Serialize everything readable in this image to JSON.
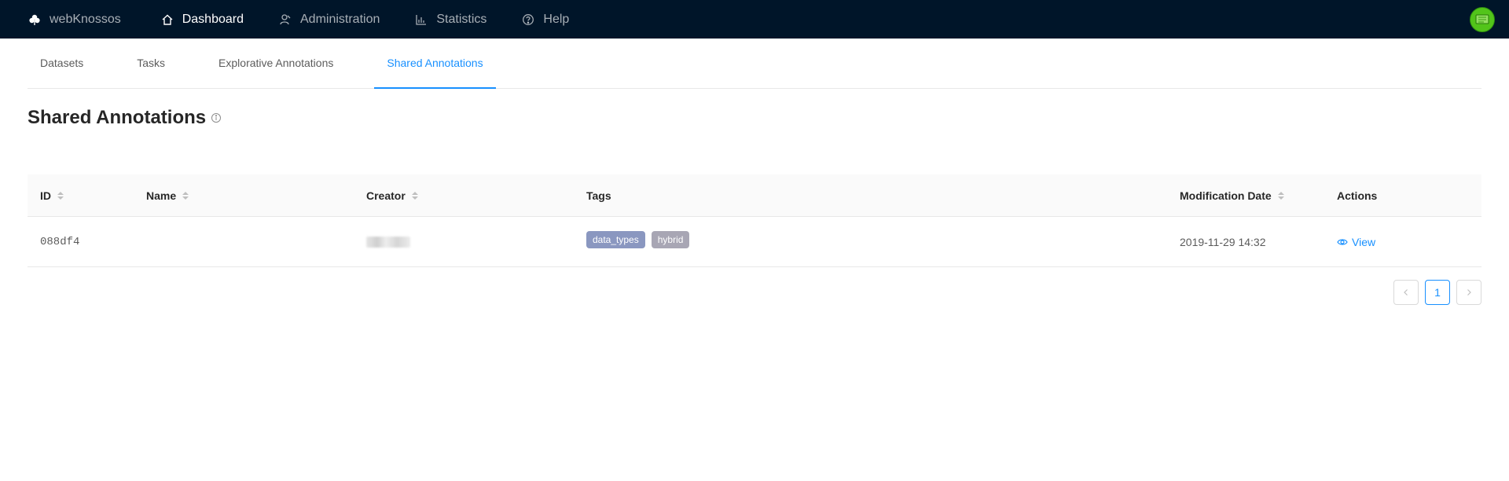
{
  "nav": {
    "brand": "webKnossos",
    "items": [
      {
        "label": "Dashboard",
        "icon": "home-icon",
        "active": true
      },
      {
        "label": "Administration",
        "icon": "user-icon",
        "active": false
      },
      {
        "label": "Statistics",
        "icon": "bar-chart-icon",
        "active": false
      },
      {
        "label": "Help",
        "icon": "question-circle-icon",
        "active": false
      }
    ]
  },
  "tabs": [
    {
      "label": "Datasets",
      "active": false
    },
    {
      "label": "Tasks",
      "active": false
    },
    {
      "label": "Explorative Annotations",
      "active": false
    },
    {
      "label": "Shared Annotations",
      "active": true
    }
  ],
  "page": {
    "title": "Shared Annotations"
  },
  "table": {
    "columns": [
      "ID",
      "Name",
      "Creator",
      "Tags",
      "Modification Date",
      "Actions"
    ],
    "rows": [
      {
        "id": "088df4",
        "name": "",
        "creator": "",
        "tags": [
          {
            "label": "data_types",
            "color": "#8a97c0"
          },
          {
            "label": "hybrid",
            "color": "#a8a6b4"
          }
        ],
        "modified": "2019-11-29 14:32",
        "action": "View"
      }
    ]
  },
  "pagination": {
    "current": "1"
  },
  "colors": {
    "accent": "#1890ff",
    "navbar": "#001529",
    "avatar": "#52c41a"
  }
}
